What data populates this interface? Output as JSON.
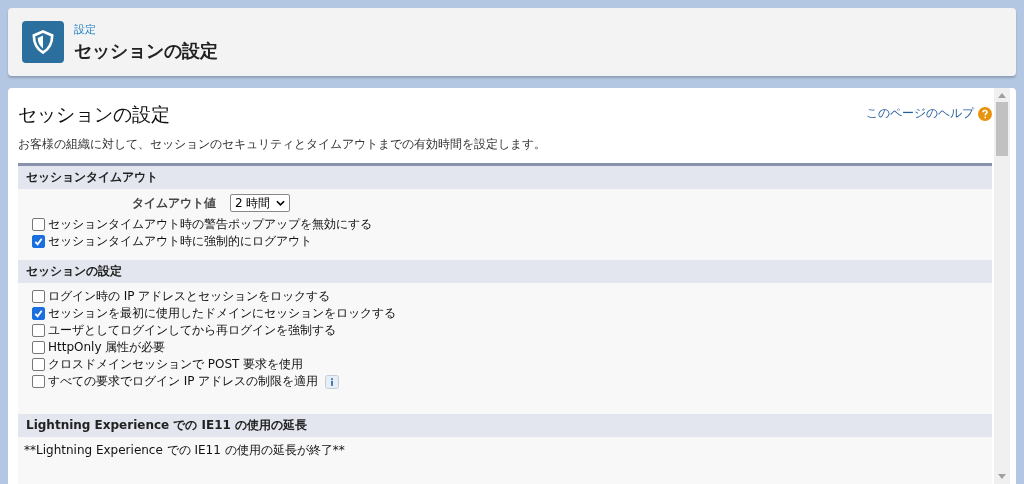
{
  "header": {
    "breadcrumb": "設定",
    "title": "セッションの設定"
  },
  "page": {
    "title": "セッションの設定",
    "help_link": "このページのヘルプ",
    "description": "お客様の組織に対して、セッションのセキュリティとタイムアウトまでの有効時間を設定します。"
  },
  "sections": [
    {
      "title": "セッションタイムアウト",
      "items": [
        {
          "kind": "select",
          "label": "タイムアウト値",
          "value": "2 時間"
        },
        {
          "kind": "checkbox",
          "label": "セッションタイムアウト時の警告ポップアップを無効にする",
          "checked": false
        },
        {
          "kind": "checkbox",
          "label": "セッションタイムアウト時に強制的にログアウト",
          "checked": true
        }
      ]
    },
    {
      "title": "セッションの設定",
      "items": [
        {
          "kind": "checkbox",
          "label": "ログイン時の IP アドレスとセッションをロックする",
          "checked": false
        },
        {
          "kind": "checkbox",
          "label": "セッションを最初に使用したドメインにセッションをロックする",
          "checked": true
        },
        {
          "kind": "checkbox",
          "label": "ユーザとしてログインしてから再ログインを強制する",
          "checked": false
        },
        {
          "kind": "checkbox",
          "label": "HttpOnly 属性が必要",
          "checked": false
        },
        {
          "kind": "checkbox",
          "label": "クロスドメインセッションで POST 要求を使用",
          "checked": false
        },
        {
          "kind": "checkbox",
          "label": "すべての要求でログイン IP アドレスの制限を適用",
          "checked": false,
          "info": true
        }
      ]
    },
    {
      "title": "Lightning Experience での IE11 の使用の延長",
      "items": [
        {
          "kind": "text",
          "label": "**Lightning Experience での IE11 の使用の延長が終了**"
        }
      ]
    }
  ]
}
